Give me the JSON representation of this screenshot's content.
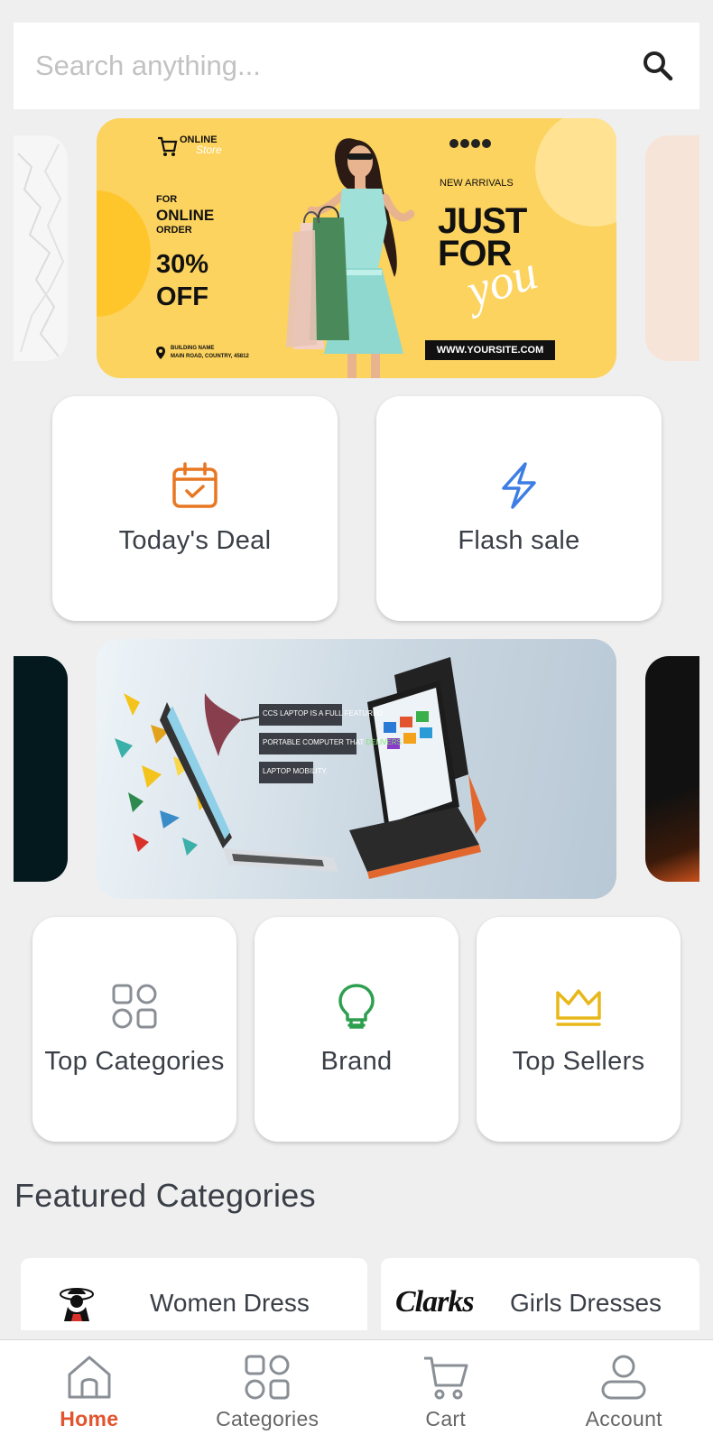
{
  "search": {
    "placeholder": "Search anything..."
  },
  "banner1": {
    "logo_line1": "ONLINE",
    "logo_line2": "Store",
    "for_text": "FOR",
    "online_text": "ONLINE",
    "order_text": "ORDER",
    "discount": "30%",
    "off_text": "OFF",
    "address_line1": "BUILDING NAME",
    "address_line2": "MAIN ROAD, COUNTRY, 45812",
    "new_arrivals": "NEW ARRIVALS",
    "headline_line1": "JUST",
    "headline_line2": "FOR",
    "headline_script": "you",
    "url": "WWW.YOURSITE.COM"
  },
  "quick_links_1": [
    {
      "label": "Today's Deal",
      "icon": "calendar-check-icon",
      "color": "#e87722"
    },
    {
      "label": "Flash sale",
      "icon": "lightning-icon",
      "color": "#3d7de6"
    }
  ],
  "banner2": {
    "line1": "CCS LAPTOP IS A FULL FEATURED",
    "line2_a": "PORTABLE COMPUTER THAT ",
    "line2_b": "DELIVERS",
    "line3": "LAPTOP MOBILITY."
  },
  "quick_links_2": [
    {
      "label": "Top Categories",
      "icon": "grid-icon",
      "color": "#8a8f96"
    },
    {
      "label": "Brand",
      "icon": "lightbulb-icon",
      "color": "#2e9e4f"
    },
    {
      "label": "Top Sellers",
      "icon": "crown-icon",
      "color": "#e8b81b"
    }
  ],
  "featured": {
    "title": "Featured Categories",
    "items": [
      {
        "label": "Women Dress"
      },
      {
        "label": "Girls Dresses",
        "brand": "Clarks"
      }
    ]
  },
  "nav": {
    "items": [
      {
        "label": "Home",
        "icon": "home-icon",
        "active": true
      },
      {
        "label": "Categories",
        "icon": "grid-icon",
        "active": false
      },
      {
        "label": "Cart",
        "icon": "cart-icon",
        "active": false
      },
      {
        "label": "Account",
        "icon": "user-icon",
        "active": false
      }
    ],
    "active_color": "#e2542e"
  }
}
